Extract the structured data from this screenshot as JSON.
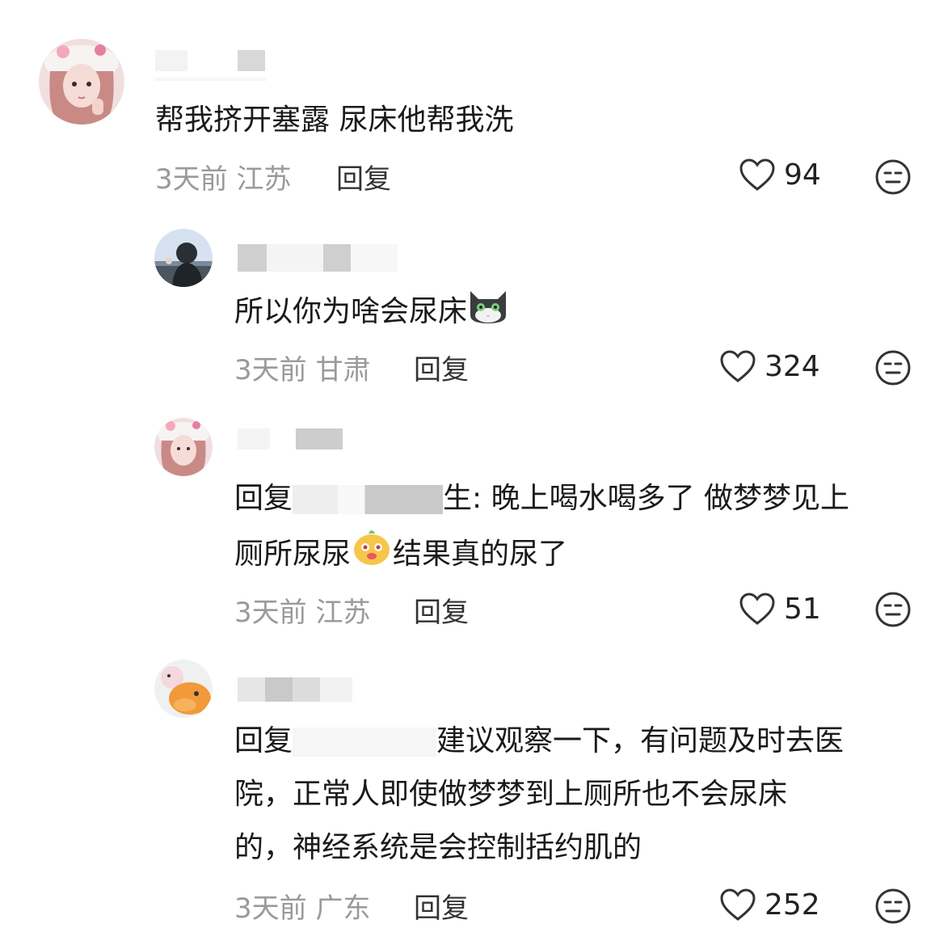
{
  "comments": [
    {
      "text": "帮我挤开塞露 尿床他帮我洗",
      "time": "3天前",
      "location": "江苏",
      "reply_label": "回复",
      "likes": "94"
    },
    {
      "text_pre": "所以你为啥会尿床",
      "emoji": "cat-emoji",
      "time": "3天前",
      "location": "甘肃",
      "reply_label": "回复",
      "likes": "324"
    },
    {
      "reply_prefix": "回复",
      "line1_after": "生: 晚上喝水喝多了 做梦梦见上",
      "line2_pre": "厕所尿尿",
      "emoji": "duck-emoji",
      "line2_post": "结果真的尿了",
      "time": "3天前",
      "location": "江苏",
      "reply_label": "回复",
      "likes": "51"
    },
    {
      "reply_prefix": "回复",
      "line1_after": "建议观察一下，有问题及时去医",
      "line2": "院，正常人即使做梦梦到上厕所也不会尿床",
      "line3": "的，神经系统是会控制括约肌的",
      "time": "3天前",
      "location": "广东",
      "reply_label": "回复",
      "likes": "252"
    }
  ],
  "icons": {
    "like": "heart-outline-icon",
    "dislike": "neutral-face-icon"
  },
  "colors": {
    "meta": "#9a9a9a",
    "text": "#1a1a1a"
  }
}
